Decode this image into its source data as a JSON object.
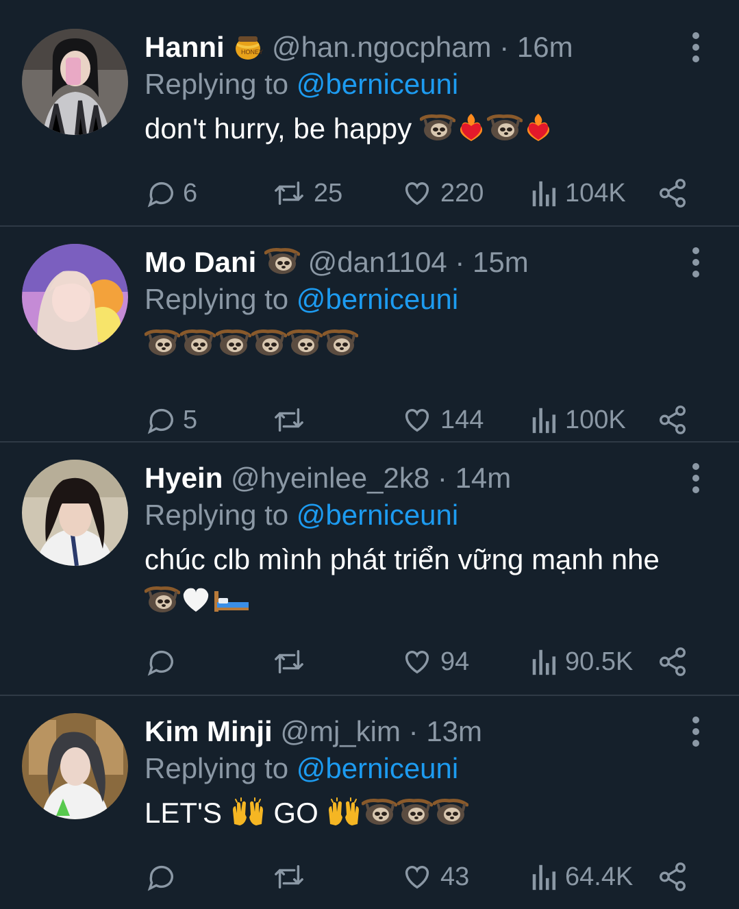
{
  "tweets": [
    {
      "name": "Hanni",
      "handle": "@han.ngocpham",
      "dot": "·",
      "time": "16m",
      "replying_prefix": "Replying to",
      "replying_to": "@berniceuni",
      "text": "don't hurry, be happy",
      "name_emoji": "honey-pot",
      "text_emojis": [
        "sloth",
        "heart-on-fire",
        "sloth",
        "heart-on-fire"
      ],
      "replies": "6",
      "retweets": "25",
      "likes": "220",
      "views": "104K"
    },
    {
      "name": "Mo Dani",
      "handle": "@dan1104",
      "dot": "·",
      "time": "15m",
      "replying_prefix": "Replying to",
      "replying_to": "@berniceuni",
      "text": "",
      "name_emoji": "sloth",
      "text_emojis": [
        "sloth",
        "sloth",
        "sloth",
        "sloth",
        "sloth",
        "sloth"
      ],
      "replies": "5",
      "retweets": "",
      "likes": "144",
      "views": "100K"
    },
    {
      "name": "Hyein",
      "handle": "@hyeinlee_2k8",
      "dot": "·",
      "time": "14m",
      "replying_prefix": "Replying to",
      "replying_to": "@berniceuni",
      "text": "chúc clb mình phát triển vững mạnh nhe",
      "name_emoji": "",
      "text_emojis": [
        "sloth",
        "white-heart",
        "bed"
      ],
      "replies": "",
      "retweets": "",
      "likes": "94",
      "views": "90.5K"
    },
    {
      "name": "Kim Minji",
      "handle": "@mj_kim",
      "dot": "·",
      "time": "13m",
      "replying_prefix": "Replying to",
      "replying_to": "@berniceuni",
      "text_a": "LET'S",
      "text_b": "GO",
      "name_emoji": "",
      "text_emojis": [
        "raising-hands",
        "raising-hands",
        "sloth",
        "sloth",
        "sloth"
      ],
      "replies": "",
      "retweets": "",
      "likes": "43",
      "views": "64.4K"
    }
  ],
  "colors": {
    "background": "#15202b",
    "text": "#ffffff",
    "muted": "#8b98a5",
    "link": "#1d9bf0",
    "divider": "#2f3a46"
  }
}
